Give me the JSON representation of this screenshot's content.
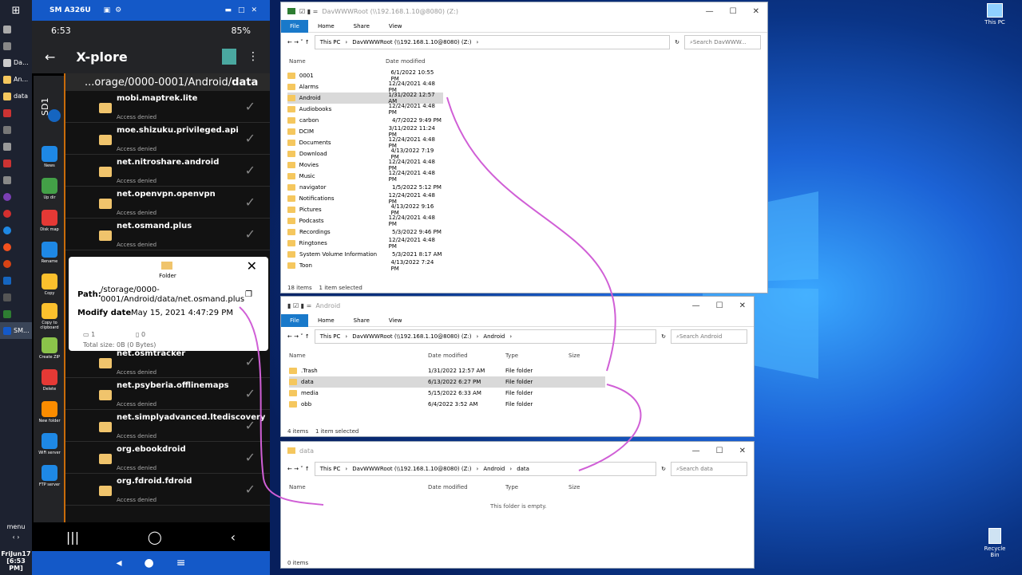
{
  "taskbar": {
    "items": [
      {
        "label": "Da..."
      },
      {
        "label": "An..."
      },
      {
        "label": "data"
      }
    ],
    "active": "SM...",
    "menu": "menu",
    "date": "FriJun17",
    "time": "[6:53 PM]"
  },
  "phone": {
    "title": "SM A326U",
    "clock": "6:53",
    "battery": "85%",
    "app": "X-plore",
    "path_prefix": "...orage/0000-0001/Android/",
    "path_bold": "data",
    "sd": "SD1",
    "tools": [
      {
        "l": "News",
        "c": "#1e88e5"
      },
      {
        "l": "Up dir",
        "c": "#43a047"
      },
      {
        "l": "Disk map",
        "c": "#e53935"
      },
      {
        "l": "Rename",
        "c": "#1e88e5"
      },
      {
        "l": "Copy",
        "c": "#fbc02d"
      },
      {
        "l": "Copy to clipboard",
        "c": "#fbc02d"
      },
      {
        "l": "Create ZIP",
        "c": "#8bc34a"
      },
      {
        "l": "Delete",
        "c": "#e53935"
      },
      {
        "l": "New folder",
        "c": "#fb8c00"
      },
      {
        "l": "WiFi server",
        "c": "#1e88e5"
      },
      {
        "l": "FTP server",
        "c": "#1e88e5"
      }
    ],
    "rows_top": [
      {
        "n": "mobi.maptrek.lite",
        "s": "Access denied"
      },
      {
        "n": "moe.shizuku.privileged.api",
        "s": "Access denied"
      },
      {
        "n": "net.nitroshare.android",
        "s": "Access denied"
      },
      {
        "n": "net.openvpn.openvpn",
        "s": "Access denied"
      },
      {
        "n": "net.osmand.plus",
        "s": "Access denied"
      }
    ],
    "rows_bottom": [
      {
        "n": "net.osmtracker",
        "s": "Access denied"
      },
      {
        "n": "net.psyberia.offlinemaps",
        "s": "Access denied"
      },
      {
        "n": "net.simplyadvanced.ltediscovery",
        "s": "Access denied"
      },
      {
        "n": "org.ebookdroid",
        "s": "Access denied"
      },
      {
        "n": "org.fdroid.fdroid",
        "s": "Access denied"
      }
    ],
    "popup": {
      "tab": "Folder",
      "path_label": "Path:",
      "path": "/storage/0000-0001/Android/data/net.osmand.plus",
      "mod_label": "Modify date",
      "mod": "May 15, 2021 4:47:29 PM",
      "folders": "1",
      "files": "0",
      "total": "Total size: 0B (0 Bytes)"
    }
  },
  "win1": {
    "title": "DavWWWRoot (\\\\192.168.1.10@8080) (Z:)",
    "tabs": [
      "File",
      "Home",
      "Share",
      "View"
    ],
    "crumbs": [
      "This PC",
      "DavWWWRoot (\\\\192.168.1.10@8080) (Z:)"
    ],
    "search": "Search DavWWW...",
    "cols": [
      "Name",
      "Date modified"
    ],
    "rows": [
      [
        "0001",
        "6/1/2022 10:55 PM"
      ],
      [
        "Alarms",
        "12/24/2021 4:48 PM"
      ],
      [
        "Android",
        "1/31/2022 12:57 AM"
      ],
      [
        "Audiobooks",
        "12/24/2021 4:48 PM"
      ],
      [
        "carbon",
        "4/7/2022 9:49 PM"
      ],
      [
        "DCIM",
        "3/11/2022 11:24 PM"
      ],
      [
        "Documents",
        "12/24/2021 4:48 PM"
      ],
      [
        "Download",
        "4/13/2022 7:19 PM"
      ],
      [
        "Movies",
        "12/24/2021 4:48 PM"
      ],
      [
        "Music",
        "12/24/2021 4:48 PM"
      ],
      [
        "navigator",
        "1/5/2022 5:12 PM"
      ],
      [
        "Notifications",
        "12/24/2021 4:48 PM"
      ],
      [
        "Pictures",
        "4/13/2022 9:16 PM"
      ],
      [
        "Podcasts",
        "12/24/2021 4:48 PM"
      ],
      [
        "Recordings",
        "5/3/2022 9:46 PM"
      ],
      [
        "Ringtones",
        "12/24/2021 4:48 PM"
      ],
      [
        "System Volume Information",
        "5/3/2021 8:17 AM"
      ],
      [
        "Toon",
        "4/13/2022 7:24 PM"
      ]
    ],
    "status_count": "18 items",
    "status_sel": "1 item selected"
  },
  "win2": {
    "title": "Android",
    "tabs": [
      "File",
      "Home",
      "Share",
      "View"
    ],
    "crumbs": [
      "This PC",
      "DavWWWRoot (\\\\192.168.1.10@8080) (Z:)",
      "Android"
    ],
    "search": "Search Android",
    "cols": [
      "Name",
      "Date modified",
      "Type",
      "Size"
    ],
    "rows": [
      [
        ".Trash",
        "1/31/2022 12:57 AM",
        "File folder"
      ],
      [
        "data",
        "6/13/2022 6:27 PM",
        "File folder"
      ],
      [
        "media",
        "5/15/2022 6:33 AM",
        "File folder"
      ],
      [
        "obb",
        "6/4/2022 3:52 AM",
        "File folder"
      ]
    ],
    "status_count": "4 items",
    "status_sel": "1 item selected"
  },
  "win3": {
    "title": "data",
    "crumbs": [
      "This PC",
      "DavWWWRoot (\\\\192.168.1.10@8080) (Z:)",
      "Android",
      "data"
    ],
    "search": "Search data",
    "cols": [
      "Name",
      "Date modified",
      "Type",
      "Size"
    ],
    "empty": "This folder is empty.",
    "status_count": "0 items"
  },
  "desktop": {
    "thispc": "This PC",
    "recycle": "Recycle Bin"
  }
}
